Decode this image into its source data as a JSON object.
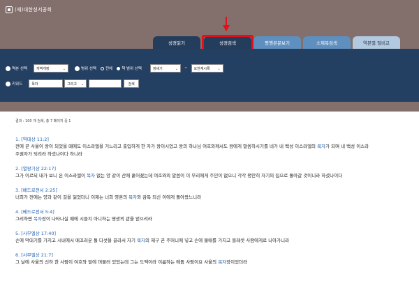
{
  "header": {
    "org_name": "(재)대한성서공회"
  },
  "tabs": [
    {
      "label": "성경읽기"
    },
    {
      "label": "성경검색"
    },
    {
      "label": "평행본문보기"
    },
    {
      "label": "소제목검색"
    },
    {
      "label": "역본별 절비교"
    }
  ],
  "search": {
    "version_label": "역본 선택",
    "version_value": "개역개정",
    "range_label": "범위 선택",
    "range_all": "전체",
    "range_part": "책 범위 선택",
    "range_from": "창세기",
    "range_sep": "~",
    "range_to": "요한계시록",
    "keyword_label": "키워드",
    "keyword1": "목자",
    "operator": "그리고",
    "keyword2": "",
    "search_button": "검색"
  },
  "summary": "결과 : 100 개 검색, 총 7 페이지 중 1",
  "results": [
    {
      "ref": "1. [역대상 11:2]",
      "lines": [
        [
          {
            "t": "전에 곧 사울이 왕이 되었을 때에도 이스라엘을 거느리고 출입하게 한 자가 왕이시었고 왕의 하나님 여호와께서도 왕에게 말씀하시기를 네가 내 백성 이스라엘의 "
          },
          {
            "t": "목자",
            "k": true
          },
          {
            "t": "가 되며 내 백성 이스라"
          }
        ],
        [
          {
            "t": "주권자가 되리라 하셨나이다 하니라"
          }
        ]
      ]
    },
    {
      "ref": "2. [열왕기상 22:17]",
      "lines": [
        [
          {
            "t": "그가 이르되 내가 보니 온 이스라엘이 "
          },
          {
            "t": "목자",
            "k": true
          },
          {
            "t": " 없는 양 같이 산에 흩어졌는데 여호와의 말씀이 이 무리에게 주인이 없으니 각각 평안히 자기의 집으로 돌아갈 것이니라 하셨나이다"
          }
        ]
      ]
    },
    {
      "ref": "3. [베드로전서 2:25]",
      "lines": [
        [
          {
            "t": "너희가 전에는 양과 같이 길을 잃었더니 이제는 너희 영혼의 "
          },
          {
            "t": "목자",
            "k": true
          },
          {
            "t": "와 감독 되신 이에게 돌아왔느니라"
          }
        ]
      ]
    },
    {
      "ref": "4. [베드로전서 5:4]",
      "lines": [
        [
          {
            "t": "그리하면 "
          },
          {
            "t": "목자",
            "k": true
          },
          {
            "t": "장이 나타나실 때에 시들지 아니하는 영광의 관을 얻으리라"
          }
        ]
      ]
    },
    {
      "ref": "5. [사무엘상 17:40]",
      "lines": [
        [
          {
            "t": "손에 막대기를 가지고 시내에서 매끄러운 돌 다섯을 골라서 자기 "
          },
          {
            "t": "목자",
            "k": true
          },
          {
            "t": "의 제구 곧 주머니에 넣고 손에 물매를 가지고 블레셋 사람에게로 나아가니라"
          }
        ]
      ]
    },
    {
      "ref": "6. [사무엘상 21:7]",
      "lines": [
        [
          {
            "t": "그 날에 사울의 신하 한 사람이 여호와 앞에 머물러 있었는데 그는 도엑이라 이름하는 에돔 사람이요 사울의 "
          },
          {
            "t": "목자",
            "k": true
          },
          {
            "t": "장이었더라"
          }
        ]
      ]
    }
  ],
  "colors": {
    "header_bg": "#836f6c",
    "panel_bg": "#233f62",
    "tab_active": "#243d5c",
    "tab_mid": "#5f8fbf",
    "tab_light": "#b3c9df",
    "link": "#1f5fb0",
    "highlight_red": "#e3101a"
  }
}
